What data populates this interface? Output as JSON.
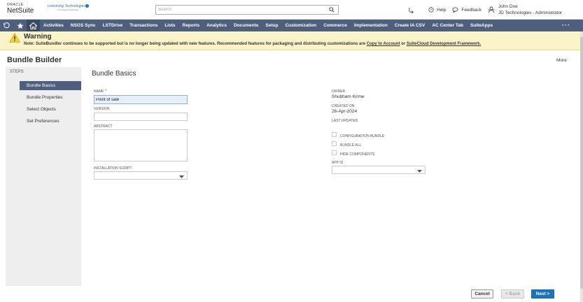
{
  "header": {
    "oracle_label": "ORACLE",
    "netsuite_label": "NetSuite",
    "company_name": "Livestrong Technologies",
    "company_tagline": "Technology Integration",
    "search_placeholder": "Search",
    "help_label": "Help",
    "feedback_label": "Feedback",
    "user_name": "John Doe",
    "user_role": "JD Technologies - Administrator"
  },
  "nav": {
    "items": [
      {
        "label": "Activities"
      },
      {
        "label": "NSGS Sync"
      },
      {
        "label": "LSTDrive"
      },
      {
        "label": "Transactions"
      },
      {
        "label": "Lists"
      },
      {
        "label": "Reports"
      },
      {
        "label": "Analytics"
      },
      {
        "label": "Documents"
      },
      {
        "label": "Setup"
      },
      {
        "label": "Customization"
      },
      {
        "label": "Commerce"
      },
      {
        "label": "Implementation"
      },
      {
        "label": "Create IA CSV"
      },
      {
        "label": "AC Center Tab"
      },
      {
        "label": "SuiteApps"
      }
    ],
    "more": "···"
  },
  "warning": {
    "title": "Warning",
    "text_prefix": "Note: SuiteBundler continues to be supported but is no longer being updated with new features. Recommended features for packaging and distributing customizations are ",
    "link1": "Copy to Account",
    "text_mid": " or ",
    "link2": "SuiteCloud Development Framework."
  },
  "page": {
    "title": "Bundle Builder",
    "more": "More"
  },
  "steps": {
    "label": "STEPS",
    "items": [
      {
        "label": "Bundle Basics",
        "active": true
      },
      {
        "label": "Bundle Properties",
        "active": false
      },
      {
        "label": "Select Objects",
        "active": false
      },
      {
        "label": "Set Preferences",
        "active": false
      }
    ]
  },
  "form": {
    "section_title": "Bundle Basics",
    "name_label": "NAME",
    "name_required": "*",
    "name_value": "Point of sale",
    "version_label": "VERSION",
    "version_value": "",
    "abstract_label": "ABSTRACT",
    "abstract_value": "",
    "installation_script_label": "INSTALLATION SCRIPT",
    "installation_script_value": "",
    "owner_label": "OWNER",
    "owner_value": "Shubham Kirme",
    "created_on_label": "CREATED ON",
    "created_on_value": "26-Apr-2024",
    "last_updated_label": "LAST UPDATED",
    "last_updated_value": "",
    "checkboxes": [
      {
        "label": "CONFIGURATION BUNDLE",
        "checked": false
      },
      {
        "label": "BUNDLE ALL",
        "checked": false
      },
      {
        "label": "HIDE COMPONENTS",
        "checked": false
      }
    ],
    "app_id_label": "APP ID",
    "app_id_value": ""
  },
  "buttons": {
    "cancel": "Cancel",
    "back": "< Back",
    "next": "Next >"
  },
  "colors": {
    "nav_bg": "#4d5f7c",
    "warning_bg": "#fcf4c9",
    "primary": "#1e73be",
    "required": "#e45a1a"
  }
}
